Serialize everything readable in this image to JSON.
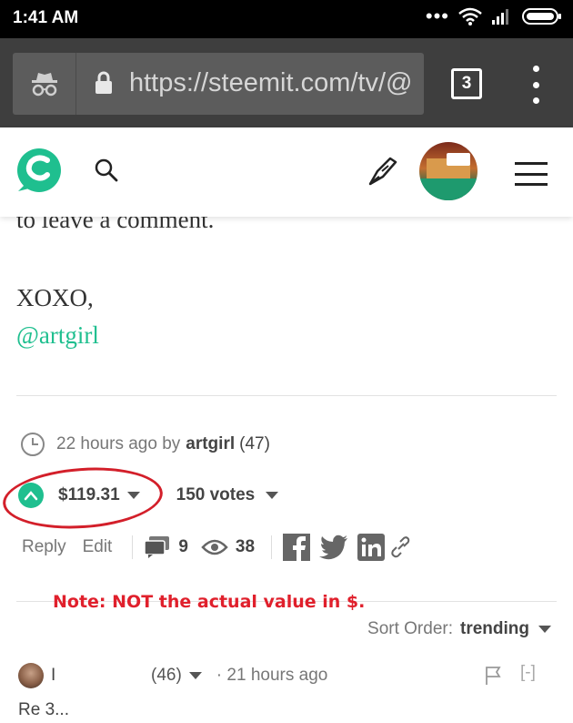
{
  "status_bar": {
    "time": "1:41 AM",
    "icons": [
      "dots-icon",
      "wifi-icon",
      "signal-icon",
      "battery-icon"
    ]
  },
  "browser": {
    "url": "https://steemit.com/tv/@",
    "tab_count": "3"
  },
  "header": {
    "icons": [
      "steemit-logo",
      "search-icon",
      "pen-icon",
      "avatar",
      "menu-icon"
    ]
  },
  "post": {
    "cut_text": "to leave a comment.",
    "signoff": "XOXO,",
    "mention": "@artgirl"
  },
  "meta": {
    "time_ago": "22 hours ago by",
    "author": "artgirl",
    "reputation": "(47)"
  },
  "payout": {
    "value": "$119.31",
    "votes": "150 votes"
  },
  "actions": {
    "reply": "Reply",
    "edit": "Edit",
    "comments": "9",
    "views": "38"
  },
  "annotation": {
    "note": "Note: NOT the actual value in $."
  },
  "sort": {
    "label": "Sort Order:",
    "value": "trending"
  },
  "comment": {
    "name": "I",
    "reputation": "(46)",
    "time": "· 21 hours ago",
    "collapse": "[-]",
    "text": "Re 3..."
  },
  "colors": {
    "accent": "#1fbf8f",
    "annotation": "#d31f2a",
    "toolbar": "#3e3e3e"
  }
}
